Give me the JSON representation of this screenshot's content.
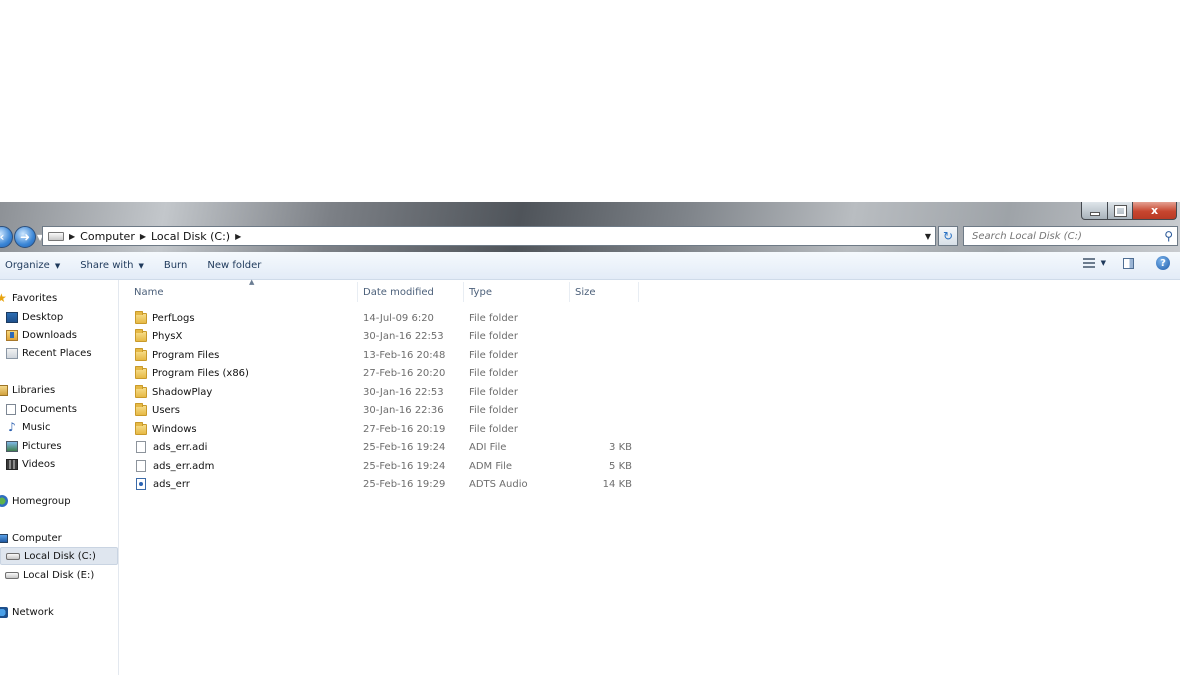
{
  "window": {
    "caption": {
      "minimize": "",
      "maximize": "",
      "close": "x"
    },
    "address": {
      "crumbs": [
        "Computer",
        "Local Disk (C:)"
      ]
    },
    "search": {
      "placeholder": "Search Local Disk (C:)"
    }
  },
  "toolbar": {
    "organize": "Organize",
    "share_with": "Share with",
    "burn": "Burn",
    "new_folder": "New folder"
  },
  "navpane": {
    "favorites": {
      "label": "Favorites",
      "items": [
        "Desktop",
        "Downloads",
        "Recent Places"
      ]
    },
    "libraries": {
      "label": "Libraries",
      "items": [
        "Documents",
        "Music",
        "Pictures",
        "Videos"
      ]
    },
    "homegroup": {
      "label": "Homegroup"
    },
    "computer": {
      "label": "Computer",
      "items": [
        "Local Disk (C:)",
        "Local Disk (E:)"
      ],
      "selected": "Local Disk (C:)"
    },
    "network": {
      "label": "Network"
    }
  },
  "columns": {
    "name": "Name",
    "date": "Date modified",
    "type": "Type",
    "size": "Size"
  },
  "files": [
    {
      "name": "PerfLogs",
      "date": "14-Jul-09 6:20",
      "type": "File folder",
      "size": "",
      "icon": "folder"
    },
    {
      "name": "PhysX",
      "date": "30-Jan-16 22:53",
      "type": "File folder",
      "size": "",
      "icon": "folder"
    },
    {
      "name": "Program Files",
      "date": "13-Feb-16 20:48",
      "type": "File folder",
      "size": "",
      "icon": "folder"
    },
    {
      "name": "Program Files (x86)",
      "date": "27-Feb-16 20:20",
      "type": "File folder",
      "size": "",
      "icon": "folder"
    },
    {
      "name": "ShadowPlay",
      "date": "30-Jan-16 22:53",
      "type": "File folder",
      "size": "",
      "icon": "folder"
    },
    {
      "name": "Users",
      "date": "30-Jan-16 22:36",
      "type": "File folder",
      "size": "",
      "icon": "folder"
    },
    {
      "name": "Windows",
      "date": "27-Feb-16 20:19",
      "type": "File folder",
      "size": "",
      "icon": "folder"
    },
    {
      "name": "ads_err.adi",
      "date": "25-Feb-16 19:24",
      "type": "ADI File",
      "size": "3 KB",
      "icon": "file"
    },
    {
      "name": "ads_err.adm",
      "date": "25-Feb-16 19:24",
      "type": "ADM File",
      "size": "5 KB",
      "icon": "file"
    },
    {
      "name": "ads_err",
      "date": "25-Feb-16 19:29",
      "type": "ADTS Audio",
      "size": "14 KB",
      "icon": "audio"
    }
  ]
}
